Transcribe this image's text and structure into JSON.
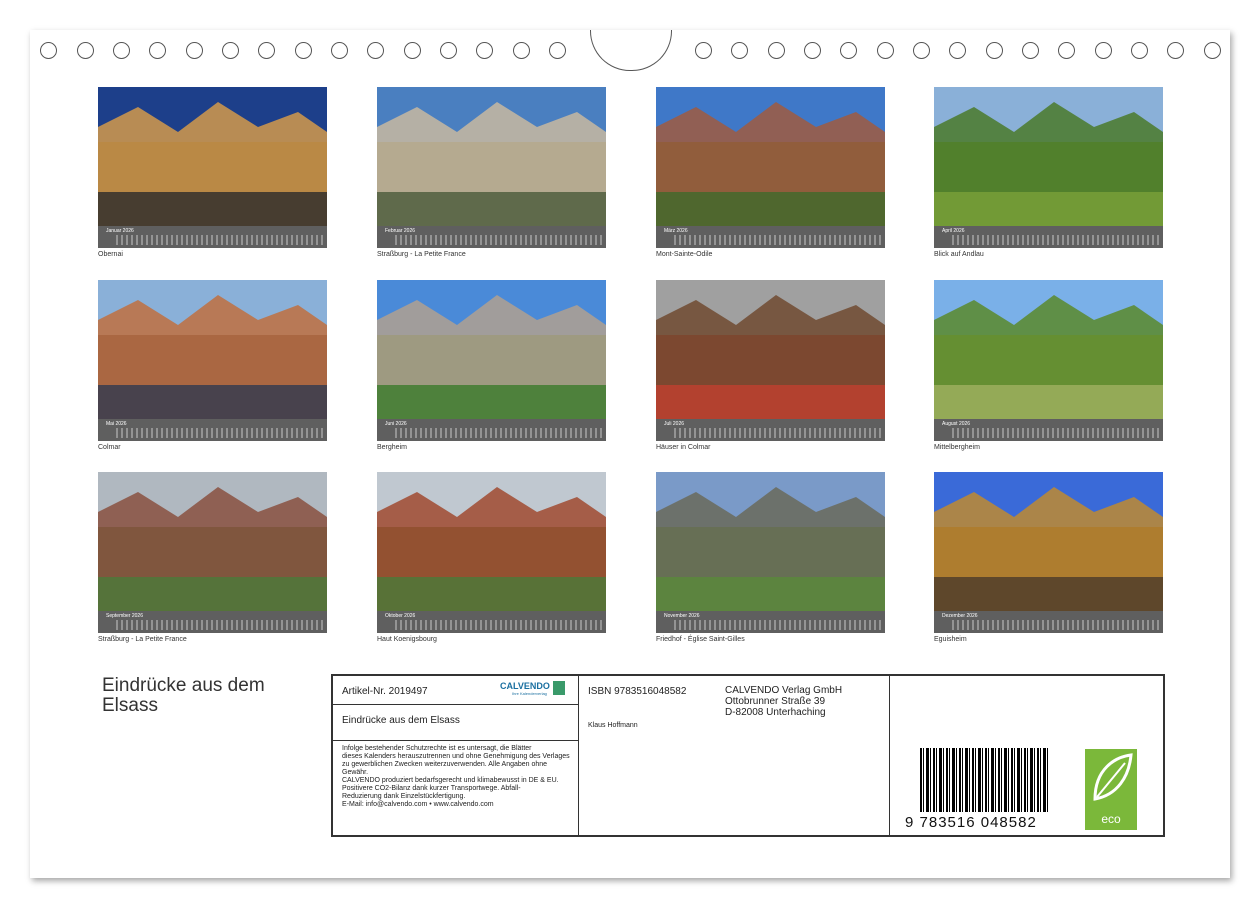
{
  "months": [
    {
      "label": "Januar 2026",
      "caption": "Obernai"
    },
    {
      "label": "Februar 2026",
      "caption": "Straßburg - La Petite France"
    },
    {
      "label": "März 2026",
      "caption": "Mont-Sainte-Odile"
    },
    {
      "label": "April 2026",
      "caption": "Blick auf Andlau"
    },
    {
      "label": "Mai 2026",
      "caption": "Colmar"
    },
    {
      "label": "Juni 2026",
      "caption": "Bergheim"
    },
    {
      "label": "Juli 2026",
      "caption": "Häuser in Colmar"
    },
    {
      "label": "August 2026",
      "caption": "Mittelbergheim"
    },
    {
      "label": "September 2026",
      "caption": "Straßburg - La Petite France"
    },
    {
      "label": "Oktober 2026",
      "caption": "Haut Koenigsbourg"
    },
    {
      "label": "November 2026",
      "caption": "Friedhof - Église Saint-Gilles"
    },
    {
      "label": "Dezember 2026",
      "caption": "Eguisheim"
    }
  ],
  "title": "Eindrücke aus dem Elsass",
  "info": {
    "article": "Artikel-Nr. 2019497",
    "book_title": "Eindrücke aus dem Elsass",
    "legal_1": "Infolge bestehender Schutzrechte ist es untersagt, die Blätter",
    "legal_2": "dieses Kalenders herauszutrennen und ohne Genehmigung des Verlages",
    "legal_3": "zu gewerblichen Zwecken weiterzuverwenden. Alle Angaben ohne",
    "legal_4": "Gewähr.",
    "legal_5": "CALVENDO produziert bedarfsgerecht und klimabewusst in DE & EU.",
    "legal_6": "Positivere CO2-Bilanz dank kurzer Transportwege. Abfall-",
    "legal_7": "Reduzierung dank Einzelstückfertigung.",
    "legal_8": "E-Mail: info@calvendo.com • www.calvendo.com",
    "isbn": "ISBN 9783516048582",
    "author": "Klaus Hoffmann",
    "publisher_1": "CALVENDO Verlag GmbH",
    "publisher_2": "Ottobrunner Straße 39",
    "publisher_3": "D-82008 Unterhaching",
    "barcode_number": "9 783516 048582",
    "logo": "CALVENDO",
    "logo_sub": "Ihre Kalenderverlag",
    "eco_label": "eco"
  },
  "photo_colors": [
    [
      "#1d3f8a",
      "#d49a4a",
      "#2b2b2b"
    ],
    [
      "#4a7fc0",
      "#c8b8a0",
      "#4a5a3a"
    ],
    [
      "#3f78c8",
      "#a05a40",
      "#3e6a2a"
    ],
    [
      "#8ab0d8",
      "#4a7a2a",
      "#7aa03a"
    ],
    [
      "#8ab0d8",
      "#c07040",
      "#303a50"
    ],
    [
      "#4a8ad8",
      "#b0a090",
      "#3a7a2a"
    ],
    [
      "#a0a0a0",
      "#704a30",
      "#c04030"
    ],
    [
      "#7ab0e8",
      "#5a8a2a",
      "#a0b060"
    ],
    [
      "#b0b8c0",
      "#8a5040",
      "#4a7a3a"
    ],
    [
      "#c0c8d0",
      "#a04a30",
      "#4a7a3a"
    ],
    [
      "#7a9ac8",
      "#6a6a5a",
      "#5a8a3a"
    ],
    [
      "#3a6ad8",
      "#c08a30",
      "#4a3a2a"
    ]
  ]
}
